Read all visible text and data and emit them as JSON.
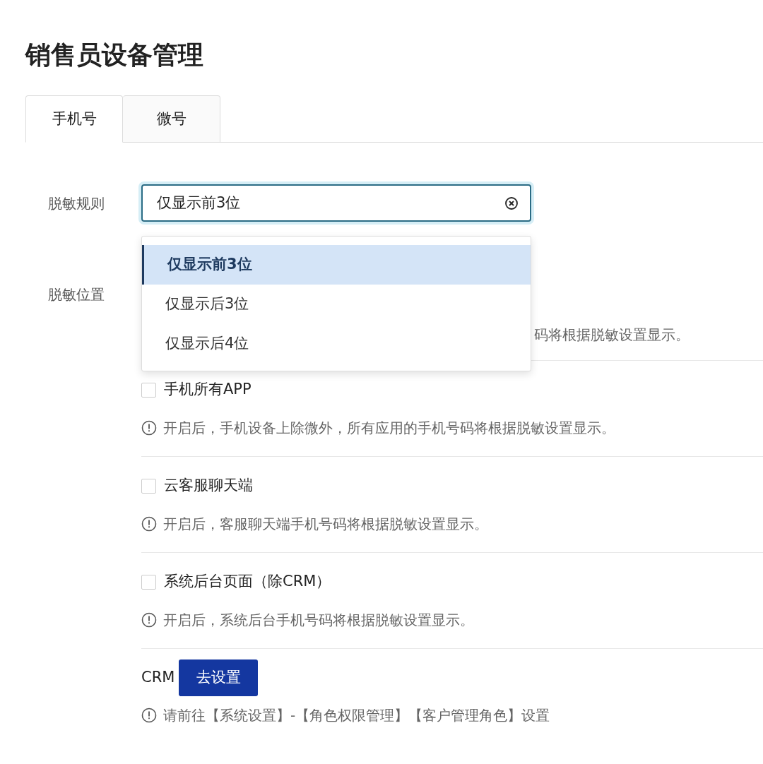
{
  "title": "销售员设备管理",
  "tabs": [
    {
      "label": "手机号",
      "selected": true
    },
    {
      "label": "微号",
      "selected": false
    }
  ],
  "rule": {
    "label": "脱敏规则",
    "value": "仅显示前3位",
    "options": [
      {
        "label": "仅显示前3位",
        "selected": true
      },
      {
        "label": "仅显示后3位",
        "selected": false
      },
      {
        "label": "仅显示后4位",
        "selected": false
      }
    ]
  },
  "location": {
    "label": "脱敏位置",
    "covered_hint": "码将根据脱敏设置显示。",
    "items": [
      {
        "label": "手机所有APP",
        "checked": false,
        "hint": "开启后，手机设备上除微外，所有应用的手机号码将根据脱敏设置显示。"
      },
      {
        "label": "云客服聊天端",
        "checked": false,
        "hint": "开启后，客服聊天端手机号码将根据脱敏设置显示。"
      },
      {
        "label": "系统后台页面（除CRM）",
        "checked": false,
        "hint": "开启后，系统后台手机号码将根据脱敏设置显示。"
      }
    ]
  },
  "crm": {
    "label": "CRM",
    "button": "去设置",
    "hint": "请前往【系统设置】-【角色权限管理】【客户管理角色】设置"
  }
}
